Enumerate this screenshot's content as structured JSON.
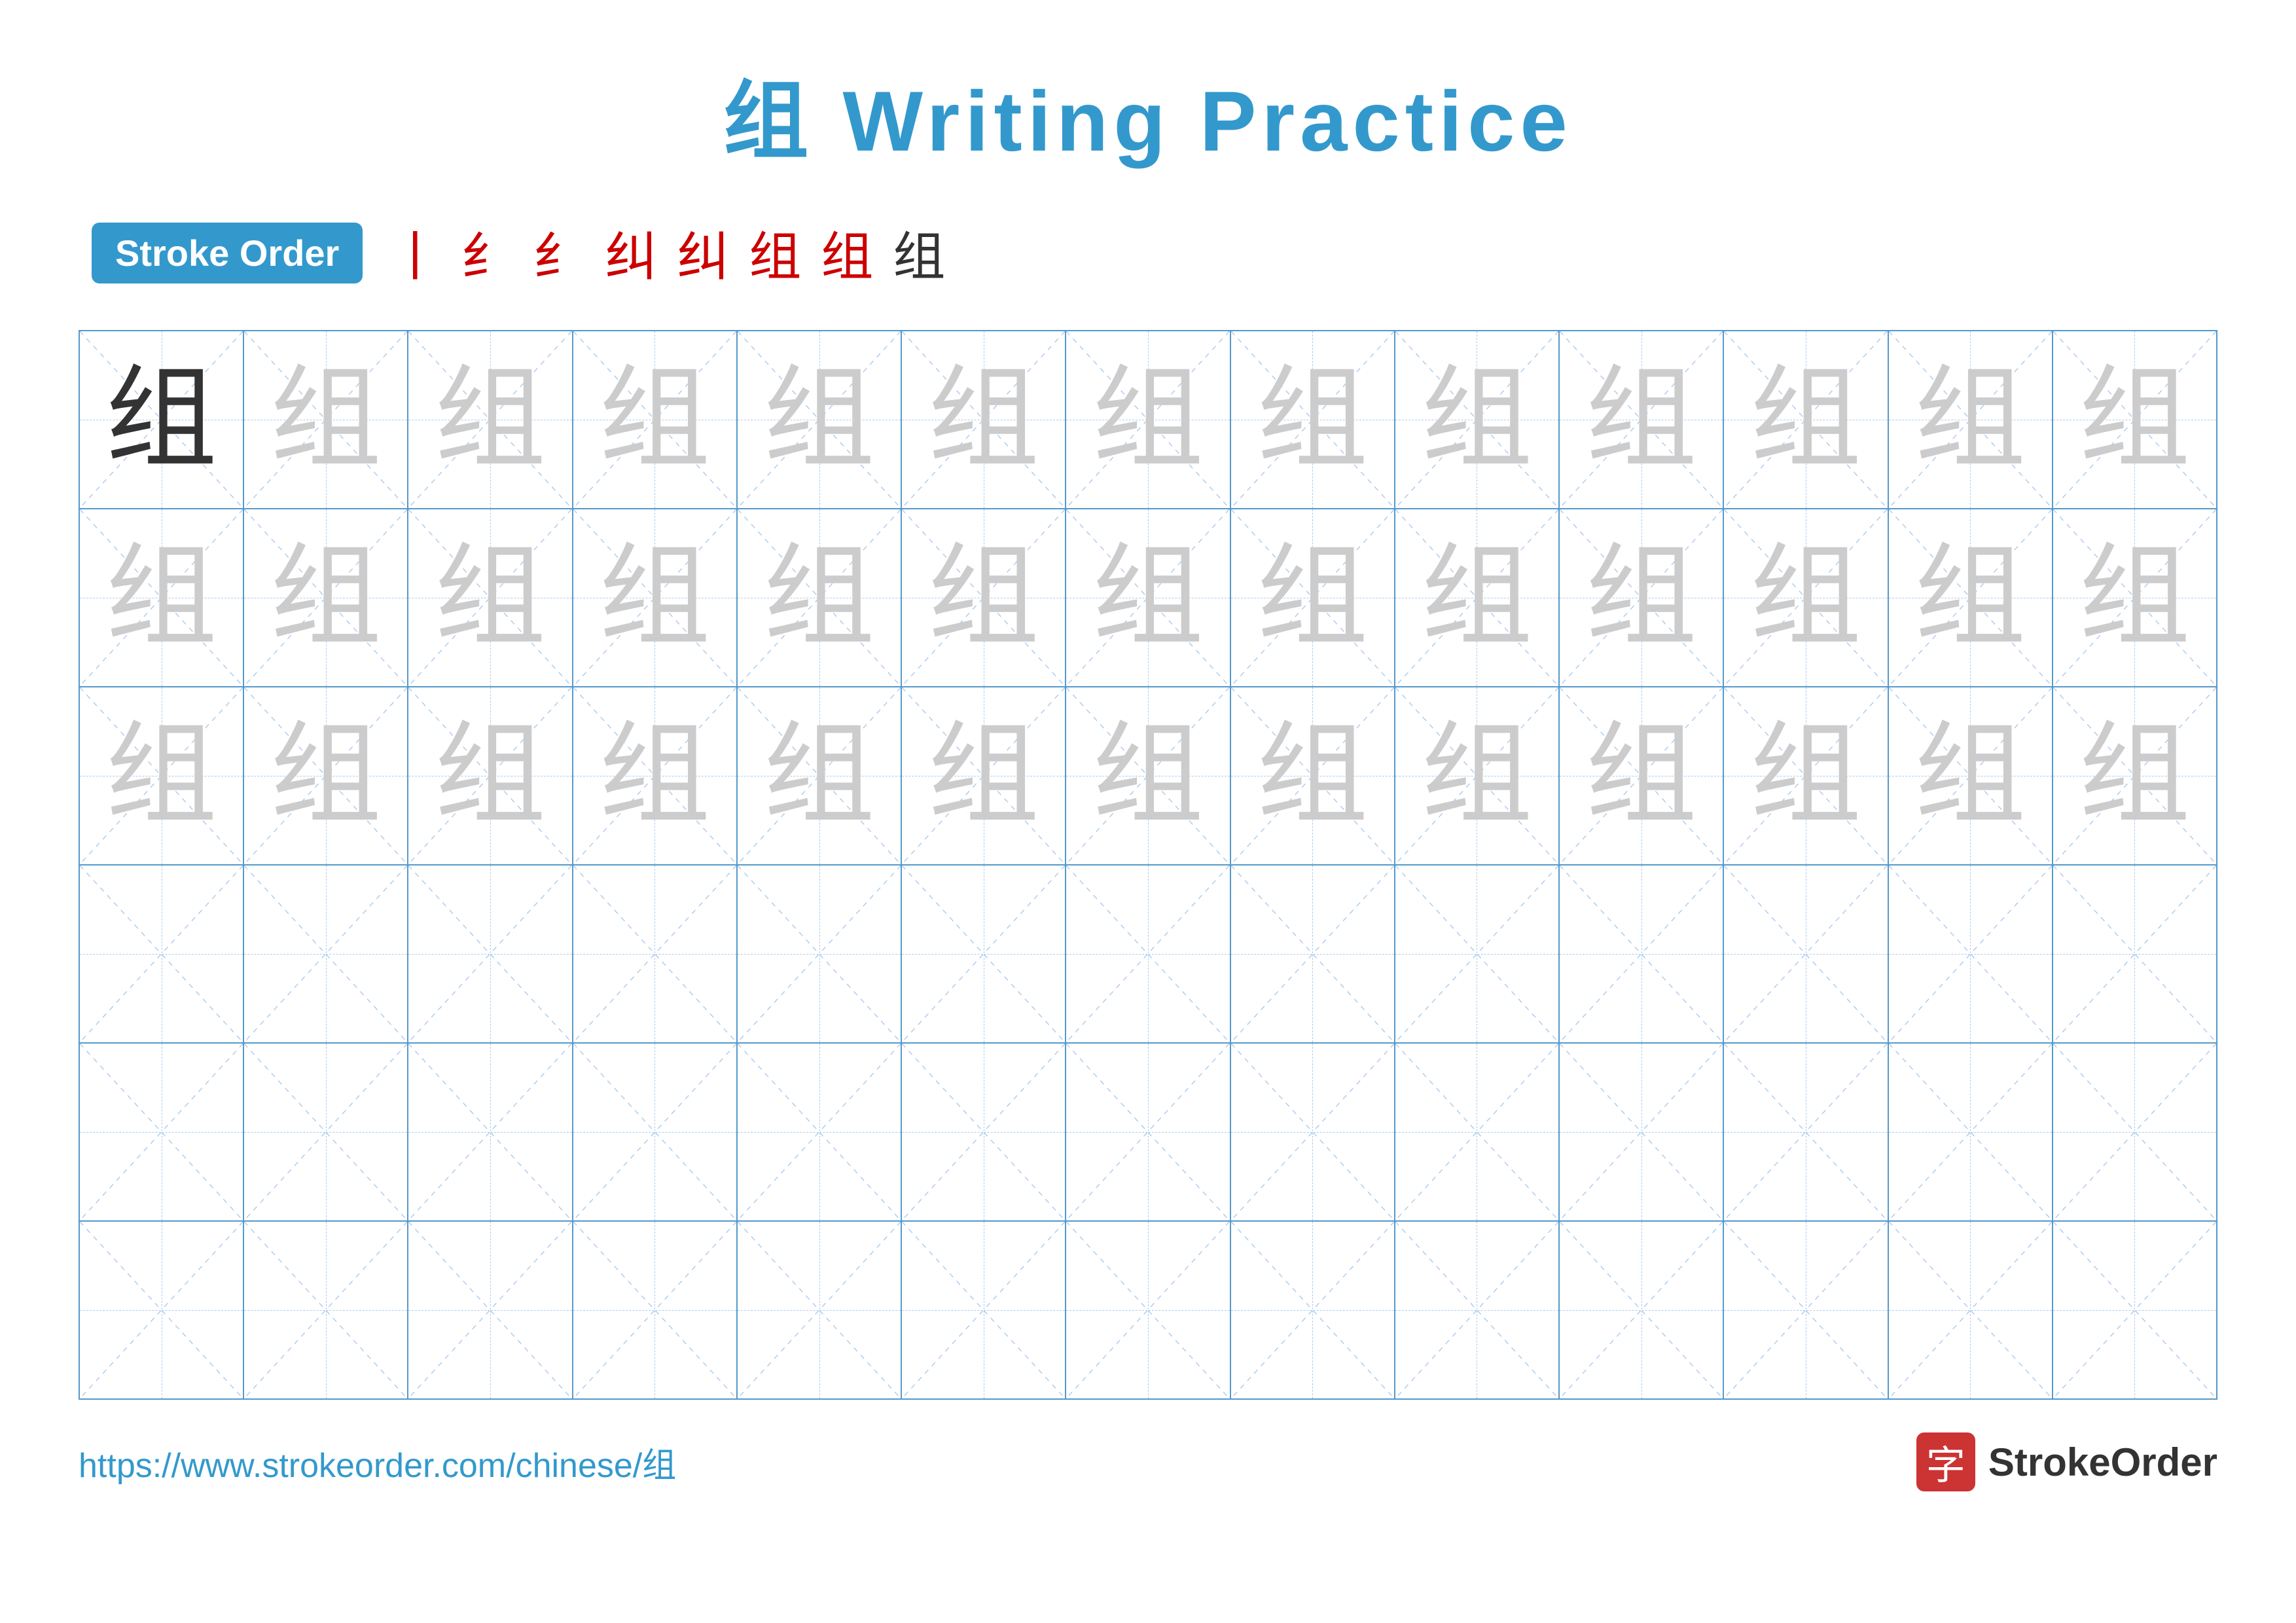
{
  "title": {
    "text": "组 Writing Practice",
    "color": "#3399cc"
  },
  "stroke_order": {
    "badge_label": "Stroke Order",
    "steps": [
      "㇀",
      "纟",
      "纟",
      "纠",
      "纠",
      "组",
      "组",
      "组"
    ]
  },
  "grid": {
    "rows": 6,
    "cols": 13,
    "char": "组",
    "row_data": [
      {
        "type": "practice",
        "first_dark": true,
        "light_count": 12
      },
      {
        "type": "practice",
        "first_dark": false,
        "light_count": 13
      },
      {
        "type": "practice",
        "first_dark": false,
        "light_count": 13
      },
      {
        "type": "empty"
      },
      {
        "type": "empty"
      },
      {
        "type": "empty"
      }
    ]
  },
  "footer": {
    "url": "https://www.strokeorder.com/chinese/组",
    "brand_name": "StrokeOrder",
    "brand_icon": "字"
  }
}
